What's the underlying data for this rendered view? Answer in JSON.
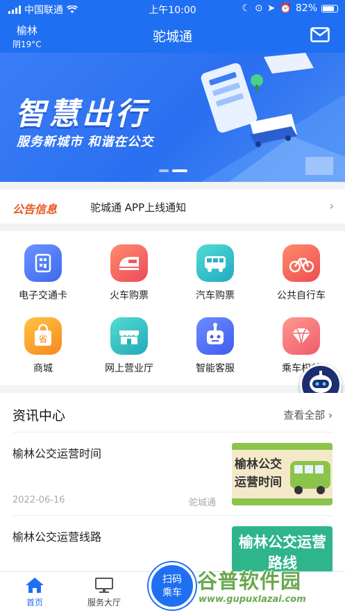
{
  "status_bar": {
    "carrier": "中国联通",
    "time": "上午10:00",
    "battery": "82%"
  },
  "header": {
    "city": "榆林",
    "weather": "阴19°C",
    "title": "驼城通",
    "mail_icon": "mail-icon"
  },
  "banner": {
    "headline": "智慧出行",
    "subline": "服务新城市 和谐在公交",
    "active_slide": 2,
    "slide_count": 2
  },
  "notice": {
    "tag": "公告信息",
    "text": "驼城通 APP上线通知"
  },
  "services": [
    {
      "label": "电子交通卡",
      "icon": "qr-card-icon",
      "color": "#4f7cf5"
    },
    {
      "label": "火车购票",
      "icon": "train-icon",
      "color": "#f05a55"
    },
    {
      "label": "汽车购票",
      "icon": "bus-icon",
      "color": "#2fc0c4"
    },
    {
      "label": "公共自行车",
      "icon": "bicycle-icon",
      "color": "#f3604f"
    },
    {
      "label": "商城",
      "icon": "shopping-bag-icon",
      "color": "#f6a623"
    },
    {
      "label": "网上营业厅",
      "icon": "storefront-icon",
      "color": "#2dbfbf"
    },
    {
      "label": "智能客服",
      "icon": "robot-icon",
      "color": "#4c6df3"
    },
    {
      "label": "乘车权益",
      "icon": "diamond-icon",
      "color": "#f2707a"
    }
  ],
  "news": {
    "heading": "资讯中心",
    "view_all": "查看全部",
    "items": [
      {
        "title": "榆林公交运营时间",
        "date": "2022-06-16",
        "source": "驼城通",
        "thumb_text": "榆林公交运营时间"
      },
      {
        "title": "榆林公交运营线路",
        "date": "",
        "source": "",
        "thumb_text": "榆林公交运营路线"
      }
    ]
  },
  "tabbar": {
    "home": "首页",
    "hall": "服务大厅",
    "scan_line1": "扫码",
    "scan_line2": "乘车",
    "active_color": "#1f6ff2"
  },
  "watermark": {
    "text": "谷普软件园",
    "url": "www.gupuxlazai.com"
  }
}
